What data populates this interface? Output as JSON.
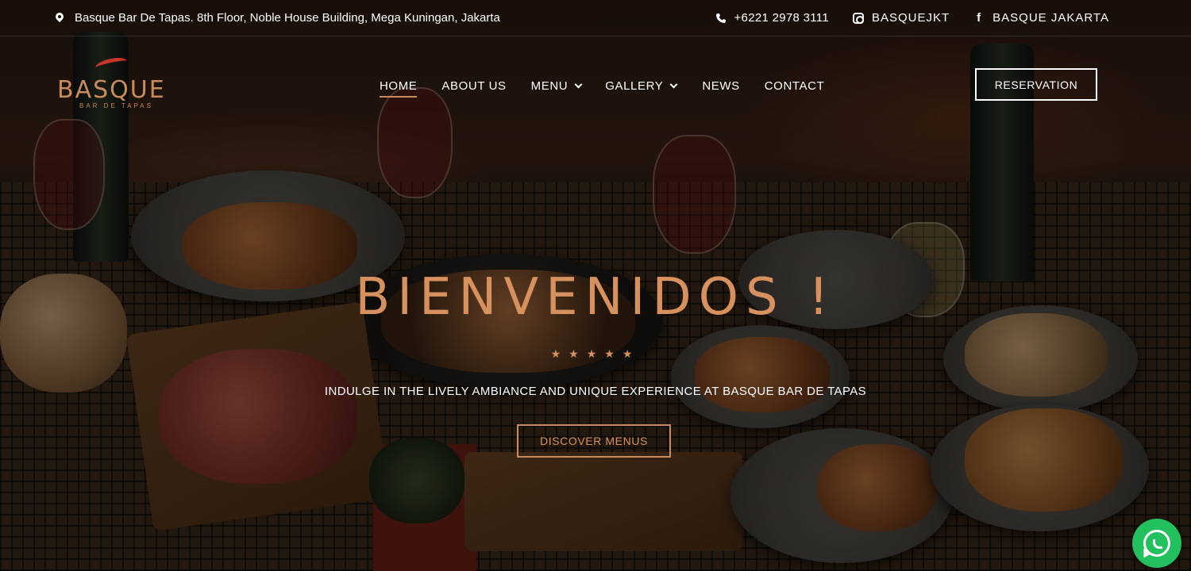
{
  "topbar": {
    "address": "Basque Bar De Tapas. 8th Floor, Noble House Building, Mega Kuningan, Jakarta",
    "phone": "+6221 2978 3111",
    "instagram": "BASQUEJKT",
    "facebook": "BASQUE JAKARTA"
  },
  "logo": {
    "name": "BASQUE",
    "subtitle": "BAR DE TAPAS"
  },
  "nav": {
    "items": [
      {
        "label": "HOME"
      },
      {
        "label": "ABOUT US"
      },
      {
        "label": "MENU"
      },
      {
        "label": "GALLERY"
      },
      {
        "label": "NEWS"
      },
      {
        "label": "CONTACT"
      }
    ],
    "reservation_label": "RESERVATION"
  },
  "hero": {
    "title": "BIENVENIDOS !",
    "stars": "★★★★★",
    "tagline": "INDULGE IN THE LIVELY AMBIANCE AND UNIQUE EXPERIENCE AT BASQUE BAR DE TAPAS",
    "cta_label": "DISCOVER MENUS"
  },
  "colors": {
    "accent": "#d7915f",
    "whatsapp": "#22c15e",
    "logo_pepper": "#c6352a"
  },
  "icons": {
    "address": "map-pin-icon",
    "phone": "phone-icon",
    "instagram": "instagram-icon",
    "facebook": "facebook-icon",
    "whatsapp": "whatsapp-icon"
  }
}
